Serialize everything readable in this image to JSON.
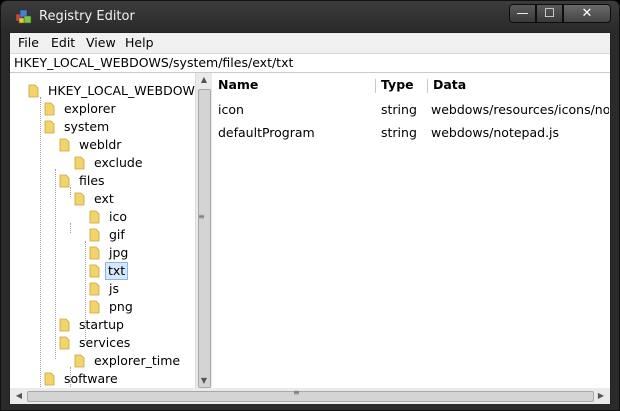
{
  "window": {
    "title": "Registry Editor",
    "minimize_glyph": "—",
    "maximize_glyph": "☐",
    "close_glyph": "✕"
  },
  "menu": [
    "File",
    "Edit",
    "View",
    "Help"
  ],
  "path": "HKEY_LOCAL_WEBDOWS/system/files/ext/txt",
  "tree": [
    {
      "label": "HKEY_LOCAL_WEBDOWS",
      "depth": 0
    },
    {
      "label": "explorer",
      "depth": 1
    },
    {
      "label": "system",
      "depth": 1
    },
    {
      "label": "webldr",
      "depth": 2
    },
    {
      "label": "exclude",
      "depth": 3
    },
    {
      "label": "files",
      "depth": 2
    },
    {
      "label": "ext",
      "depth": 3
    },
    {
      "label": "ico",
      "depth": 4
    },
    {
      "label": "gif",
      "depth": 4
    },
    {
      "label": "jpg",
      "depth": 4
    },
    {
      "label": "txt",
      "depth": 4,
      "selected": true
    },
    {
      "label": "js",
      "depth": 4
    },
    {
      "label": "png",
      "depth": 4
    },
    {
      "label": "startup",
      "depth": 2
    },
    {
      "label": "services",
      "depth": 2
    },
    {
      "label": "explorer_time",
      "depth": 3
    },
    {
      "label": "software",
      "depth": 1
    }
  ],
  "columns": [
    "Name",
    "Type",
    "Data"
  ],
  "rows": [
    {
      "name": "icon",
      "type": "string",
      "data": "webdows/resources/icons/no..."
    },
    {
      "name": "defaultProgram",
      "type": "string",
      "data": "webdows/notepad.js"
    }
  ],
  "colors": {
    "folder": "#f3d36b",
    "selection": "#d5e7fb",
    "selection_border": "#8cb6e6",
    "titlebar": "#2a2a2a"
  },
  "icons": {
    "app": "registry-editor-icon",
    "folder": "folder-icon",
    "scroll_up": "▲",
    "scroll_down": "▼",
    "scroll_left": "◀",
    "scroll_right": "▶",
    "grip": "≡"
  }
}
